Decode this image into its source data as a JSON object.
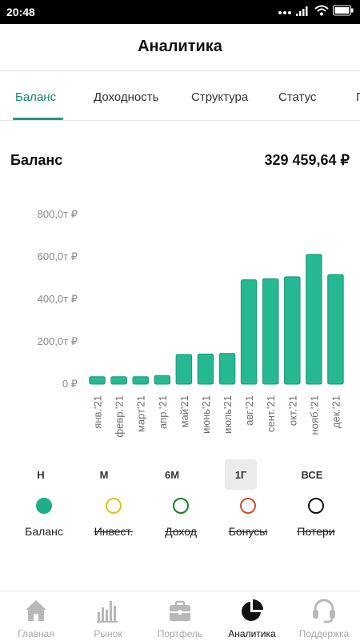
{
  "status_bar": {
    "time": "20:48"
  },
  "header": {
    "title": "Аналитика"
  },
  "tabs": [
    {
      "label": "Баланс",
      "active": true
    },
    {
      "label": "Доходность",
      "active": false
    },
    {
      "label": "Структура",
      "active": false
    },
    {
      "label": "Статус",
      "active": false
    },
    {
      "label": "П",
      "active": false
    }
  ],
  "summary": {
    "label": "Баланс",
    "value": "329 459,64 ₽"
  },
  "chart_data": {
    "type": "bar",
    "categories": [
      "янв.'21",
      "февр.'21",
      "март'21",
      "апр.'21",
      "май'21",
      "июнь'21",
      "июль'21",
      "авг.'21",
      "сент.'21",
      "окт.'21",
      "нояб.'21",
      "дек.'21"
    ],
    "values": [
      35,
      35,
      35,
      40,
      140,
      142,
      145,
      492,
      497,
      506,
      612,
      517
    ],
    "y_ticks": [
      {
        "value": 0,
        "label": "0 ₽"
      },
      {
        "value": 200,
        "label": "200,0т ₽"
      },
      {
        "value": 400,
        "label": "400,0т ₽"
      },
      {
        "value": 600,
        "label": "600,0т ₽"
      },
      {
        "value": 800,
        "label": "800,0т ₽"
      }
    ],
    "ylim": [
      0,
      800
    ],
    "y_unit": "thousand ₽",
    "grid": false,
    "bar_color": "#26b893",
    "bar_outline": "#1c9a79"
  },
  "periods": [
    {
      "label": "Н",
      "active": false
    },
    {
      "label": "М",
      "active": false
    },
    {
      "label": "6М",
      "active": false
    },
    {
      "label": "1Г",
      "active": true
    },
    {
      "label": "ВСЕ",
      "active": false
    }
  ],
  "legend": [
    {
      "label": "Баланс",
      "color": "#1fae88",
      "filled": true,
      "struck": false
    },
    {
      "label": "Инвест.",
      "color": "#e3bd22",
      "filled": false,
      "struck": true
    },
    {
      "label": "Доход",
      "color": "#16832a",
      "filled": false,
      "struck": true
    },
    {
      "label": "Бонусы",
      "color": "#c9532b",
      "filled": false,
      "struck": true
    },
    {
      "label": "Потери",
      "color": "#111111",
      "filled": false,
      "struck": true
    }
  ],
  "bottom_nav": [
    {
      "label": "Главная",
      "icon": "home-icon",
      "active": false
    },
    {
      "label": "Рынок",
      "icon": "market-bars-icon",
      "active": false
    },
    {
      "label": "Портфель",
      "icon": "briefcase-icon",
      "active": false
    },
    {
      "label": "Аналитика",
      "icon": "pie-chart-icon",
      "active": true
    },
    {
      "label": "Поддержка",
      "icon": "headset-icon",
      "active": false
    }
  ],
  "colors": {
    "accent": "#1f9a7e",
    "nav_inactive": "#b8b8b8",
    "nav_active": "#111111"
  }
}
